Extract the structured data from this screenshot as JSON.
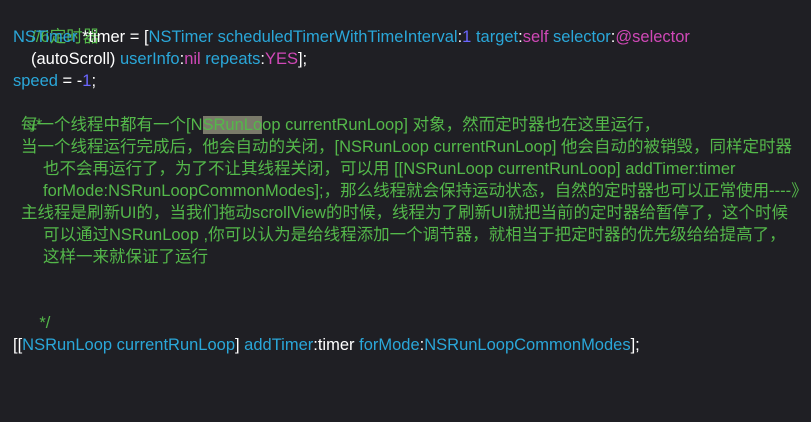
{
  "code": {
    "l1_comment": "//6定时器",
    "l2": {
      "type": "NSTimer",
      "decl": " *timer = [",
      "cls": "NSTimer",
      "sp1": " ",
      "method": "scheduledTimerWithTimeInterval",
      "colon1": ":",
      "num": "1",
      "sp2": " ",
      "target": "target",
      "colon2": ":",
      "self": "self",
      "sp3": " ",
      "selector": "selector",
      "colon3": ":",
      "at_selector": "@selector"
    },
    "l3": {
      "arg": "(autoScroll)",
      "sp1": " ",
      "userinfo": "userInfo",
      "colon1": ":",
      "nil": "nil",
      "sp2": " ",
      "repeats": "repeats",
      "colon2": ":",
      "yes": "YES",
      "end": "];"
    },
    "l4": {
      "var": "speed",
      "eq": " = -",
      "num": "1",
      "semi": ";"
    },
    "l5_comment_open": "/*",
    "comment_p1_a": "每一个线程中都有一个[N",
    "comment_p1_hl": "SRunLo",
    "comment_p1_b": "op currentRunLoop] 对象，然而定时器也在这里运行，",
    "comment_p2": "当一个线程运行完成后，他会自动的关闭，[NSRunLoop currentRunLoop] 他会自动的被销毁，同样定时器也不会再运行了，为了不让其线程关闭，可以用   [[NSRunLoop currentRunLoop] addTimer:timer forMode:NSRunLoopCommonModes];，那么线程就会保持运动状态，自然的定时器也可以正常使用----》",
    "comment_p3": "主线程是刷新UI的，当我们拖动scrollView的时候，线程为了刷新UI就把当前的定时器给暂停了，这个时候可以通过NSRunLoop  ,你可以认为是给线程添加一个调节器，就相当于把定时器的优先级给给提高了，这样一来就保证了运行",
    "comment_close": "*/",
    "last": {
      "open": "[[",
      "cls": "NSRunLoop",
      "sp1": " ",
      "method": "currentRunLoop",
      "close1": "] ",
      "addtimer": "addTimer",
      "colon1": ":",
      "timer": "timer",
      "sp2": " ",
      "formode": "forMode",
      "colon2": ":",
      "mode": "NSRunLoopCommonModes",
      "end": "];"
    }
  },
  "colors": {
    "background": "#1f1f24",
    "comment": "#54b84a",
    "class": "#2aa7d9",
    "number": "#6b66ff",
    "keyword": "#d048b7",
    "string": "#e65b57",
    "text": "#ffffff",
    "highlight": "#7a7a6a"
  }
}
